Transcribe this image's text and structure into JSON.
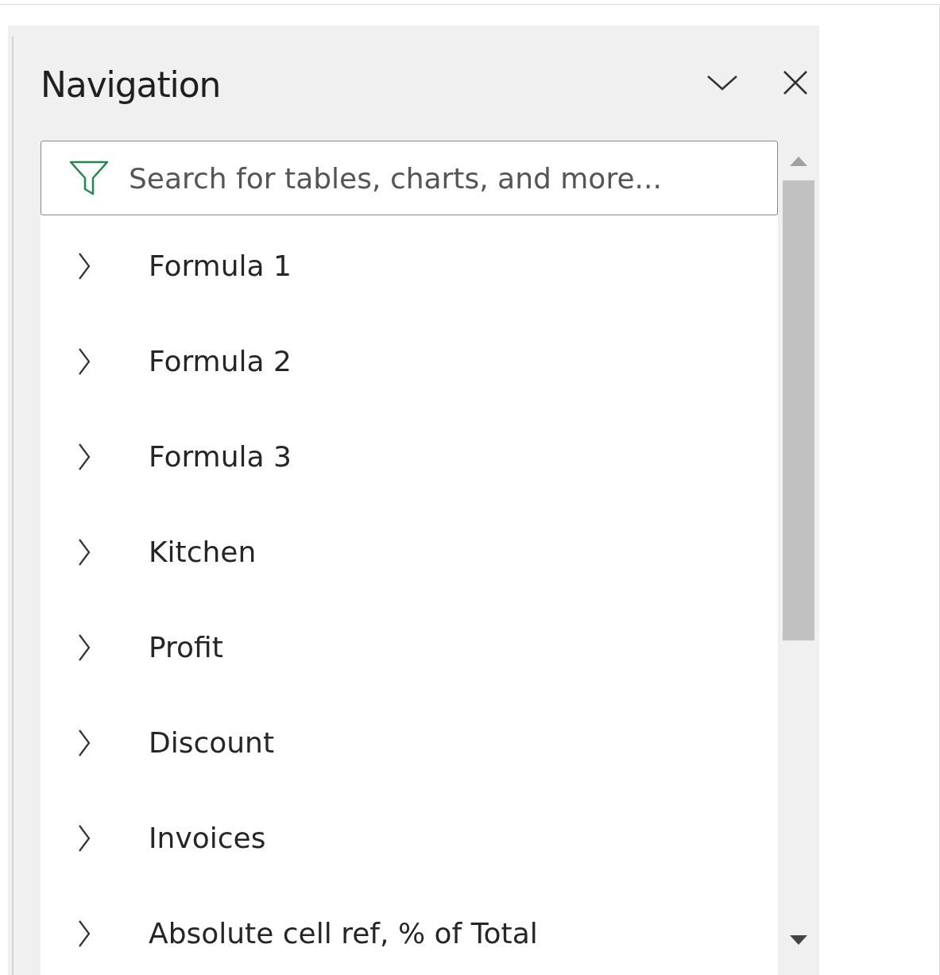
{
  "panel": {
    "title": "Navigation"
  },
  "search": {
    "placeholder": "Search for tables, charts, and more..."
  },
  "items": [
    {
      "label": "Formula 1",
      "expanded": false
    },
    {
      "label": "Formula 2",
      "expanded": false
    },
    {
      "label": "Formula 3",
      "expanded": false
    },
    {
      "label": "Kitchen",
      "expanded": false
    },
    {
      "label": "Profit",
      "expanded": false
    },
    {
      "label": "Discount",
      "expanded": false
    },
    {
      "label": "Invoices",
      "expanded": false
    },
    {
      "label": "Absolute cell ref, % of Total",
      "expanded": false
    }
  ]
}
